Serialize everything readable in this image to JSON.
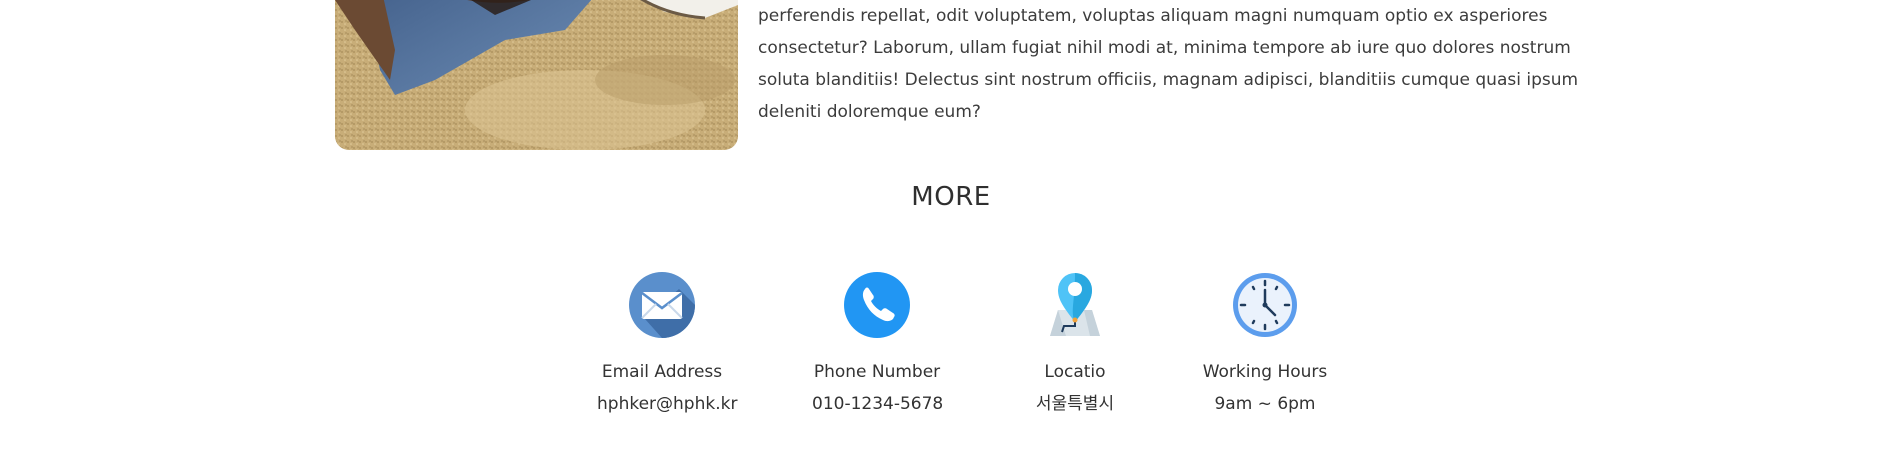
{
  "story": {
    "paragraph": "perferendis repellat, odit voluptatem, voluptas aliquam magni numquam optio ex asperiores consectetur? Laborum, ullam fugiat nihil modi at, minima tempore ab iure quo dolores nostrum soluta blanditiis! Delectus sint nostrum officiis, magnam adipisci, blanditiis cumque quasi ipsum deleniti doloremque eum?"
  },
  "more": {
    "title": "MORE"
  },
  "contacts": [
    {
      "icon": "mail-icon",
      "label": "Email Address",
      "value": "hphker@hphk.kr"
    },
    {
      "icon": "phone-icon",
      "label": "Phone Number",
      "value": "010-1234-5678"
    },
    {
      "icon": "map-pin-icon",
      "label": "Locatio",
      "value": "서울특별시"
    },
    {
      "icon": "clock-icon",
      "label": "Working Hours",
      "value": "9am ~ 6pm"
    }
  ],
  "colors": {
    "text": "#333333",
    "mail_icon": "#4a7fbf",
    "phone_icon": "#2196f3",
    "pin_icon": "#4fc3f7",
    "clock_icon": "#5c9ded"
  }
}
